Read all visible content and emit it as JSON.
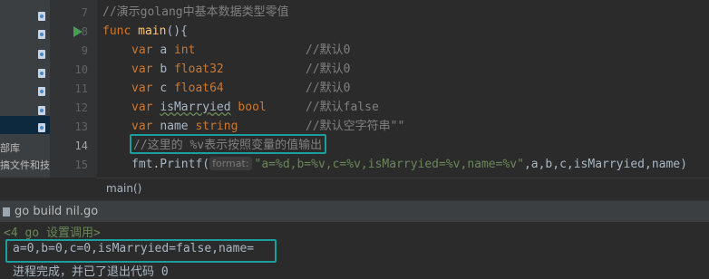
{
  "tree": {
    "items": [
      "部库",
      "搞文件和技"
    ]
  },
  "gutter": {
    "lines": [
      "7",
      "8",
      "9",
      "10",
      "11",
      "12",
      "13",
      "14",
      "15"
    ]
  },
  "code": {
    "comment_title": "//演示golang中基本数据类型零值",
    "func_kw": "func",
    "func_name": "main",
    "func_rest": "(){",
    "decls": [
      {
        "kw": "var",
        "name": "a",
        "type": "int",
        "comment": "//默认0"
      },
      {
        "kw": "var",
        "name": "b",
        "type": "float32",
        "comment": "//默认0"
      },
      {
        "kw": "var",
        "name": "c",
        "type": "float64",
        "comment": "//默认0"
      },
      {
        "kw": "var",
        "name": "isMarryied",
        "type": "bool",
        "comment": "//默认false"
      },
      {
        "kw": "var",
        "name": "name",
        "type": "string",
        "comment": "//默认空字符串\"\""
      }
    ],
    "comment_v": "//这里的 %v表示按照变量的值输出",
    "printf_call": "fmt.Printf(",
    "printf_hint": "format:",
    "printf_string": "\"a=%d,b=%v,c=%v,isMarryied=%v,name=%v\"",
    "printf_args": ",a,b,c,isMarryied,name)"
  },
  "breadcrumb": {
    "text": "main()"
  },
  "run": {
    "tab_label": "go build nil.go",
    "line1": "<4 go 设置调用>",
    "output": "a=0,b=0,c=0,isMarryied=false,name=",
    "line3": "进程完成，并已了退出代码 0"
  },
  "colors": {
    "highlight_box": "#1a9e9e"
  }
}
